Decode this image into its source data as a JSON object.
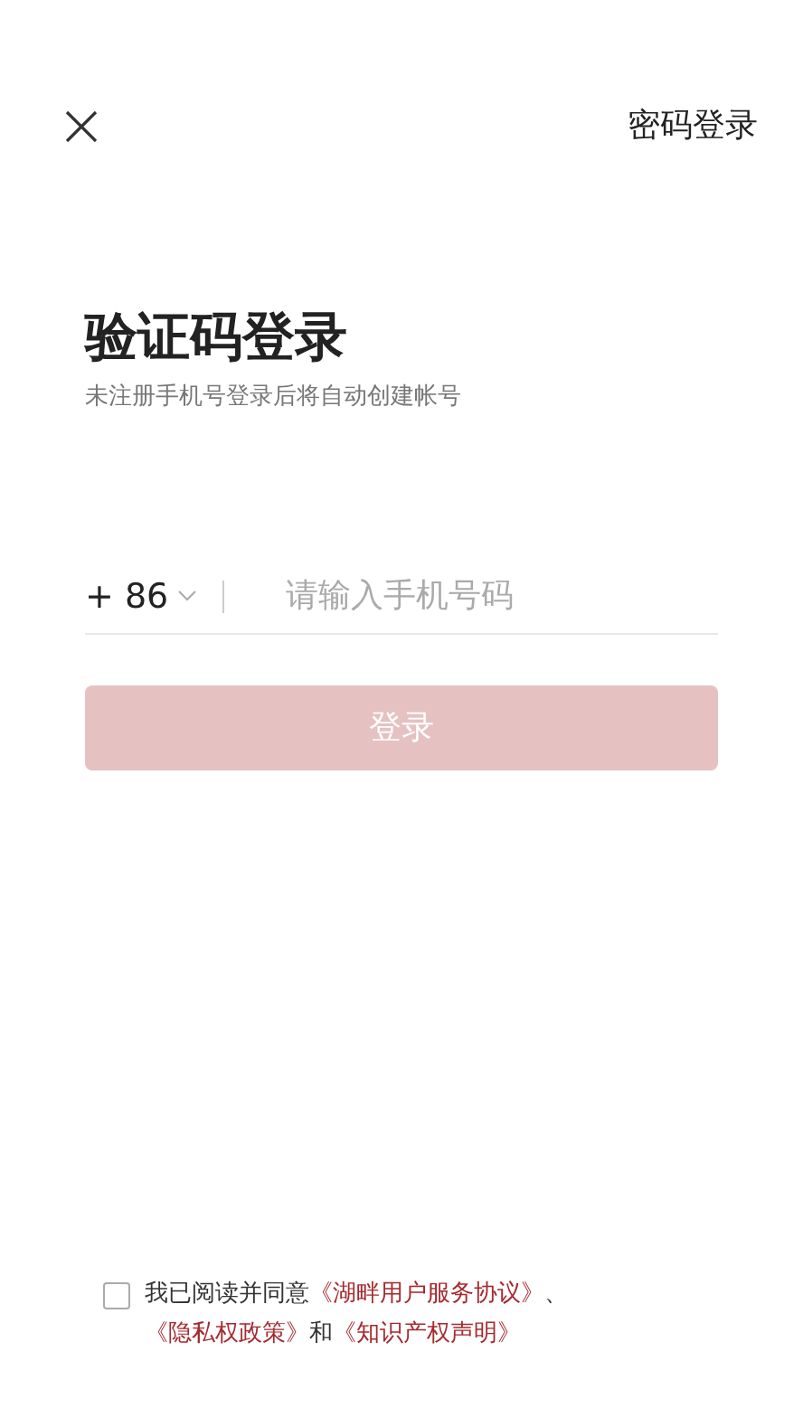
{
  "header": {
    "switch_link": "密码登录"
  },
  "title": "验证码登录",
  "subtitle": "未注册手机号登录后将自动创建帐号",
  "phone": {
    "country_code": "+ 86",
    "placeholder": "请输入手机号码"
  },
  "login_button": {
    "label": "登录",
    "disabled": true
  },
  "agreement": {
    "checked": false,
    "parts": [
      {
        "kind": "text",
        "text": "我已阅读并同意"
      },
      {
        "kind": "link",
        "text": "《湖畔用户服务协议》"
      },
      {
        "kind": "text",
        "text": "、"
      },
      {
        "kind": "link",
        "text": "《隐私权政策》"
      },
      {
        "kind": "text",
        "text": "和"
      },
      {
        "kind": "link",
        "text": "《知识产权声明》"
      }
    ]
  }
}
